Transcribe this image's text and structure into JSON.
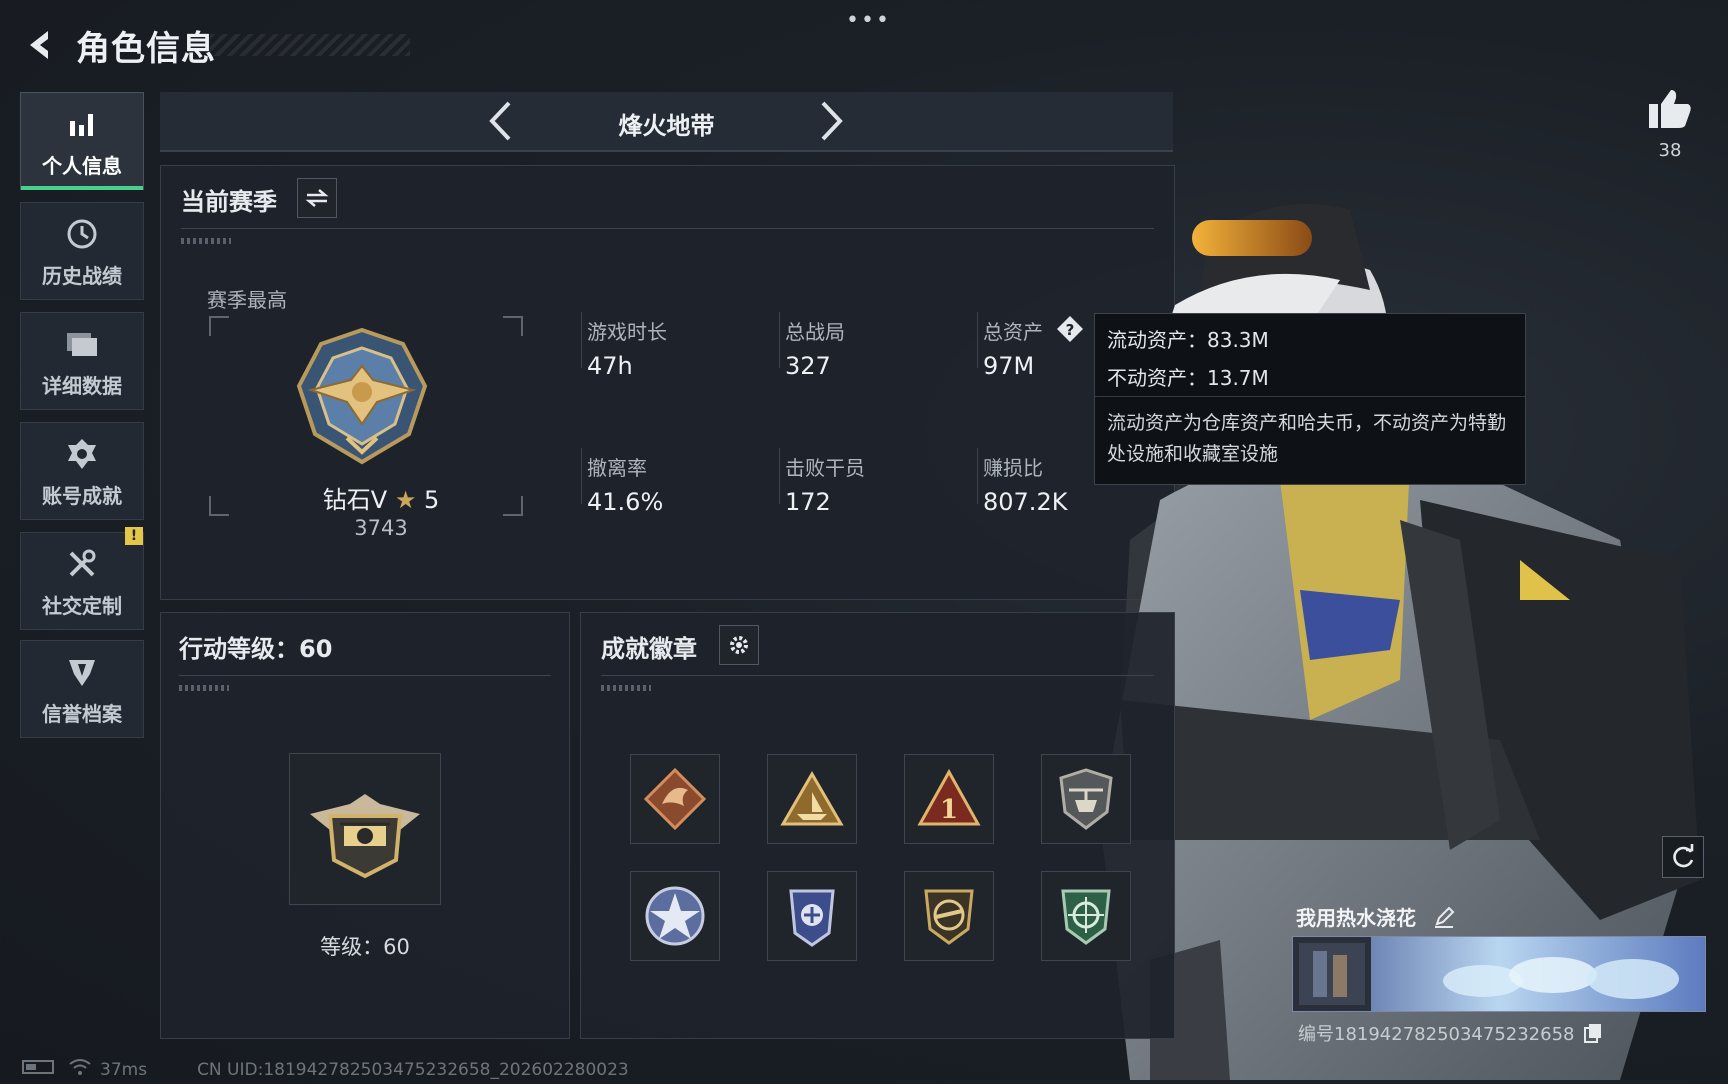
{
  "header": {
    "title": "角色信息",
    "more": "•••"
  },
  "sidebar": {
    "items": [
      {
        "label": "个人信息",
        "icon": "bar-chart-icon"
      },
      {
        "label": "历史战绩",
        "icon": "history-clock-icon"
      },
      {
        "label": "详细数据",
        "icon": "folder-icon"
      },
      {
        "label": "账号成就",
        "icon": "achievement-icon",
        "alert": "!"
      },
      {
        "label": "社交定制",
        "icon": "tools-icon"
      },
      {
        "label": "信誉档案",
        "icon": "credit-shield-icon"
      }
    ]
  },
  "mode": {
    "name": "烽火地带"
  },
  "season": {
    "title": "当前赛季",
    "best_label": "赛季最高",
    "rank_name": "钻石V",
    "rank_stars": "5",
    "rank_score": "3743",
    "stats": [
      {
        "label": "游戏时长",
        "value": "47h"
      },
      {
        "label": "总战局",
        "value": "327"
      },
      {
        "label": "总资产",
        "value": "97M"
      },
      {
        "label": "撤离率",
        "value": "41.6%"
      },
      {
        "label": "击败干员",
        "value": "172"
      },
      {
        "label": "赚损比",
        "value": "807.2K"
      }
    ]
  },
  "tooltip": {
    "liquid": "流动资产：83.3M",
    "fixed": "不动资产：13.7M",
    "desc": "流动资产为仓库资产和哈夫币，不动资产为特勤处设施和收藏室设施"
  },
  "action_level": {
    "title": "行动等级：60",
    "level_text": "等级：60"
  },
  "badges": {
    "title": "成就徽章",
    "items": [
      "dragon-badge-icon",
      "triangle-ship-badge-icon",
      "rank-one-badge-icon",
      "helicopter-shield-badge-icon",
      "star-badge-icon",
      "police-badge-icon",
      "gun-shield-badge-icon",
      "crosshair-shield-badge-icon"
    ]
  },
  "character": {
    "likes": "38",
    "card_name": "我用热水浇花",
    "card_id": "编号181942782503475232658"
  },
  "status_bar": {
    "ping": "37ms",
    "uid": "CN UID:181942782503475232658_202602280023"
  },
  "colors": {
    "accent": "#49d28f",
    "gold": "#c9a65a",
    "warning": "#e3c64a"
  }
}
